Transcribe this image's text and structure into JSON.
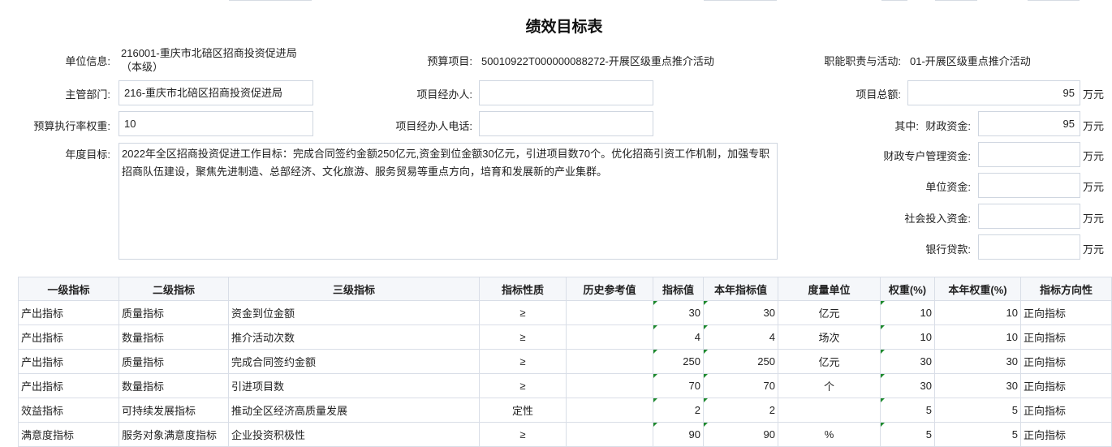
{
  "title": "绩效目标表",
  "info": {
    "unit_label": "单位信息:",
    "unit_value": "216001-重庆市北碚区招商投资促进局（本级）",
    "budget_item_label": "预算项目:",
    "budget_item_value": "50010922T000000088272-开展区级重点推介活动",
    "duty_label": "职能职责与活动:",
    "duty_value": "01-开展区级重点推介活动",
    "dept_label": "主管部门:",
    "dept_value": "216-重庆市北碚区招商投资促进局",
    "manager_label": "项目经办人:",
    "manager_value": "",
    "total_label": "项目总额:",
    "total_value": "95",
    "total_unit": "万元",
    "weight_label": "预算执行率权重:",
    "weight_value": "10",
    "phone_label": "项目经办人电话:",
    "phone_value": "",
    "among_label": "其中:",
    "fiscal_label": "财政资金:",
    "fiscal_value": "95",
    "fiscal_unit": "万元",
    "annual_label": "年度目标:",
    "annual_value": "2022年全区招商投资促进工作目标：完成合同签约金额250亿元,资金到位金额30亿元，引进项目数70个。优化招商引资工作机制，加强专职招商队伍建设，聚焦先进制造、总部经济、文化旅游、服务贸易等重点方向，培育和发展新的产业集群。",
    "special_label": "财政专户管理资金:",
    "special_value": "",
    "special_unit": "万元",
    "unitfund_label": "单位资金:",
    "unitfund_value": "",
    "unitfund_unit": "万元",
    "social_label": "社会投入资金:",
    "social_value": "",
    "social_unit": "万元",
    "loan_label": "银行贷款:",
    "loan_value": "",
    "loan_unit": "万元"
  },
  "table": {
    "headers": [
      "一级指标",
      "二级指标",
      "三级指标",
      "指标性质",
      "历史参考值",
      "指标值",
      "本年指标值",
      "度量单位",
      "权重(%)",
      "本年权重(%)",
      "指标方向性"
    ],
    "rows": [
      [
        "产出指标",
        "质量指标",
        "资金到位金额",
        "≥",
        "",
        "30",
        "30",
        "亿元",
        "10",
        "10",
        "正向指标"
      ],
      [
        "产出指标",
        "数量指标",
        "推介活动次数",
        "≥",
        "",
        "4",
        "4",
        "场次",
        "10",
        "10",
        "正向指标"
      ],
      [
        "产出指标",
        "质量指标",
        "完成合同签约金额",
        "≥",
        "",
        "250",
        "250",
        "亿元",
        "30",
        "30",
        "正向指标"
      ],
      [
        "产出指标",
        "数量指标",
        "引进项目数",
        "≥",
        "",
        "70",
        "70",
        "个",
        "30",
        "30",
        "正向指标"
      ],
      [
        "效益指标",
        "可持续发展指标",
        "推动全区经济高质量发展",
        "定性",
        "",
        "2",
        "2",
        "",
        "5",
        "5",
        "正向指标"
      ],
      [
        "满意度指标",
        "服务对象满意度指标",
        "企业投资积极性",
        "≥",
        "",
        "90",
        "90",
        "%",
        "5",
        "5",
        "正向指标"
      ]
    ]
  }
}
